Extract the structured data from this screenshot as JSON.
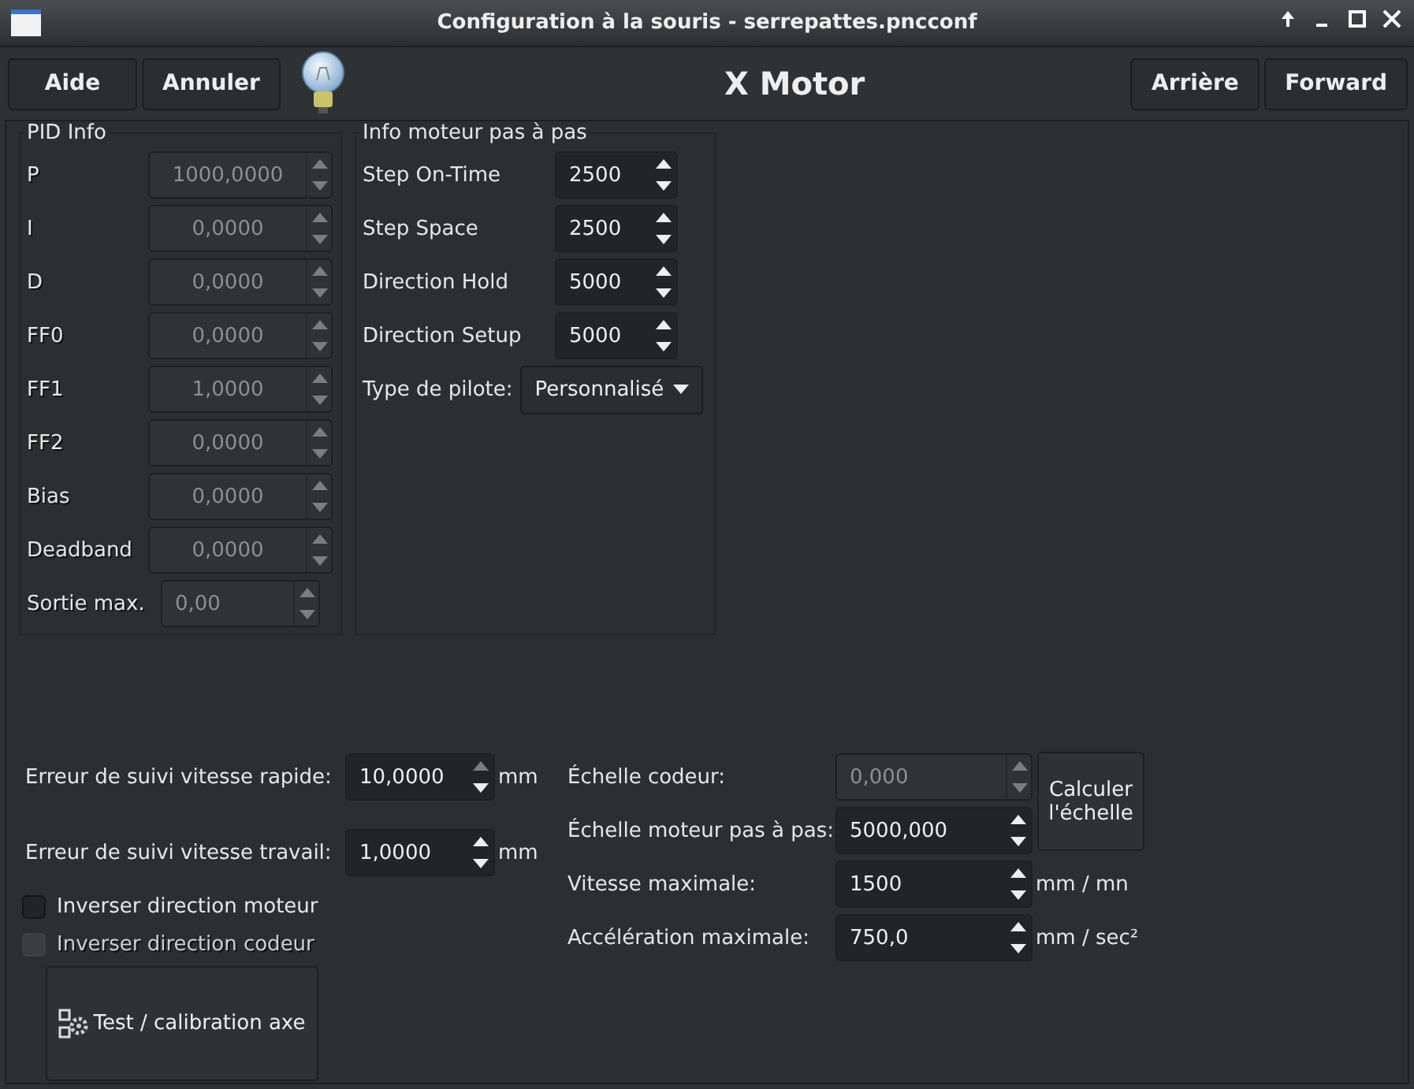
{
  "window": {
    "title": "Configuration à la souris - serrepattes.pncconf"
  },
  "toolbar": {
    "left_buttons": [
      "Aide",
      "Annuler"
    ],
    "heading": "X Motor",
    "right_buttons": [
      "Arrière",
      "Forward"
    ]
  },
  "pid": {
    "title": "PID Info",
    "rows": [
      {
        "label": "P",
        "value": "1000,0000",
        "disabled": true
      },
      {
        "label": "I",
        "value": "0,0000",
        "disabled": true
      },
      {
        "label": "D",
        "value": "0,0000",
        "disabled": true
      },
      {
        "label": "FF0",
        "value": "0,0000",
        "disabled": true
      },
      {
        "label": "FF1",
        "value": "1,0000",
        "disabled": true
      },
      {
        "label": "FF2",
        "value": "0,0000",
        "disabled": true
      },
      {
        "label": "Bias",
        "value": "0,0000",
        "disabled": true
      },
      {
        "label": "Deadband",
        "value": "0,0000",
        "disabled": true
      }
    ],
    "max_output": {
      "label": "Sortie max.",
      "value": "0,00",
      "disabled": true
    }
  },
  "stepper": {
    "title": "Info moteur pas à pas",
    "rows": [
      {
        "label": "Step On-Time",
        "value": "2500",
        "disabled": false
      },
      {
        "label": "Step Space",
        "value": "2500",
        "disabled": false
      },
      {
        "label": "Direction Hold",
        "value": "5000",
        "disabled": false
      },
      {
        "label": "Direction Setup",
        "value": "5000",
        "disabled": false
      }
    ],
    "driver": {
      "label": "Type de pilote:",
      "value": "Personnalisé"
    }
  },
  "following_errors": [
    {
      "label": "Erreur de suivi vitesse rapide:",
      "value": "10,0000",
      "unit": "mm",
      "disabled": false
    },
    {
      "label": "Erreur de suivi vitesse travail:",
      "value": "1,0000",
      "unit": "mm",
      "disabled": false
    }
  ],
  "checkboxes": [
    {
      "label": "Inverser direction moteur",
      "checked": false,
      "disabled": false
    },
    {
      "label": "Inverser direction codeur",
      "checked": false,
      "disabled": true
    }
  ],
  "test_button": "Test / calibration axe",
  "scales": [
    {
      "label": "Échelle codeur:",
      "value": "0,000",
      "disabled": true
    },
    {
      "label": "Échelle moteur pas à pas:",
      "value": "5000,000",
      "disabled": false
    }
  ],
  "calc_button": "Calculer l'échelle",
  "limits": [
    {
      "label": "Vitesse maximale:",
      "value": "1500",
      "unit": "mm / mn",
      "disabled": false
    },
    {
      "label": "Accélération maximale:",
      "value": "750,0",
      "unit": "mm / sec²",
      "disabled": false
    }
  ]
}
